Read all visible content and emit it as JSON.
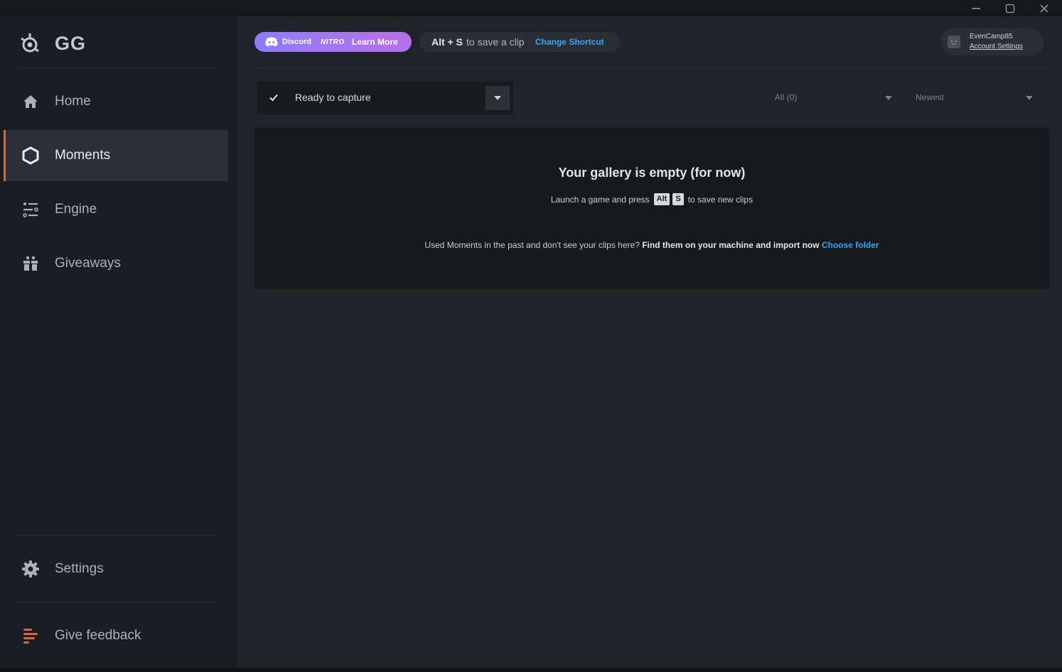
{
  "window": {
    "minimize_icon": "minimize-icon",
    "maximize_icon": "maximize-icon",
    "close_icon": "close-icon"
  },
  "app": {
    "logo_text": "GG"
  },
  "sidebar": {
    "items": [
      {
        "label": "Home",
        "icon": "home-icon"
      },
      {
        "label": "Moments",
        "icon": "hexagon-icon",
        "active": true
      },
      {
        "label": "Engine",
        "icon": "sliders-icon"
      },
      {
        "label": "Giveaways",
        "icon": "gift-icon"
      }
    ],
    "settings_label": "Settings",
    "feedback_label": "Give feedback"
  },
  "header": {
    "nitro": {
      "discord_label": "Discord",
      "nitro_label": "NITRO",
      "learn_more": "Learn More"
    },
    "shortcut": {
      "keys": "Alt + S",
      "text": "to save a clip",
      "change_label": "Change Shortcut"
    },
    "account": {
      "username": "EvenCamp85",
      "settings_link": "Account Settings"
    }
  },
  "capture": {
    "status": "Ready to capture"
  },
  "filters": {
    "category": "All (0)",
    "sort": "Newest"
  },
  "gallery": {
    "title": "Your gallery is empty (for now)",
    "launch_text_before": "Launch a game and press",
    "key1": "Alt",
    "key2": "S",
    "launch_text_after": "to save new clips",
    "import_text": "Used Moments in the past and don't see your clips here?",
    "import_bold": "Find them on your machine and import now",
    "import_link": "Choose folder"
  },
  "colors": {
    "accent": "#ff5a1f",
    "link": "#37a4f0",
    "nitro_start": "#8f7bff",
    "nitro_end": "#b86fe6"
  }
}
